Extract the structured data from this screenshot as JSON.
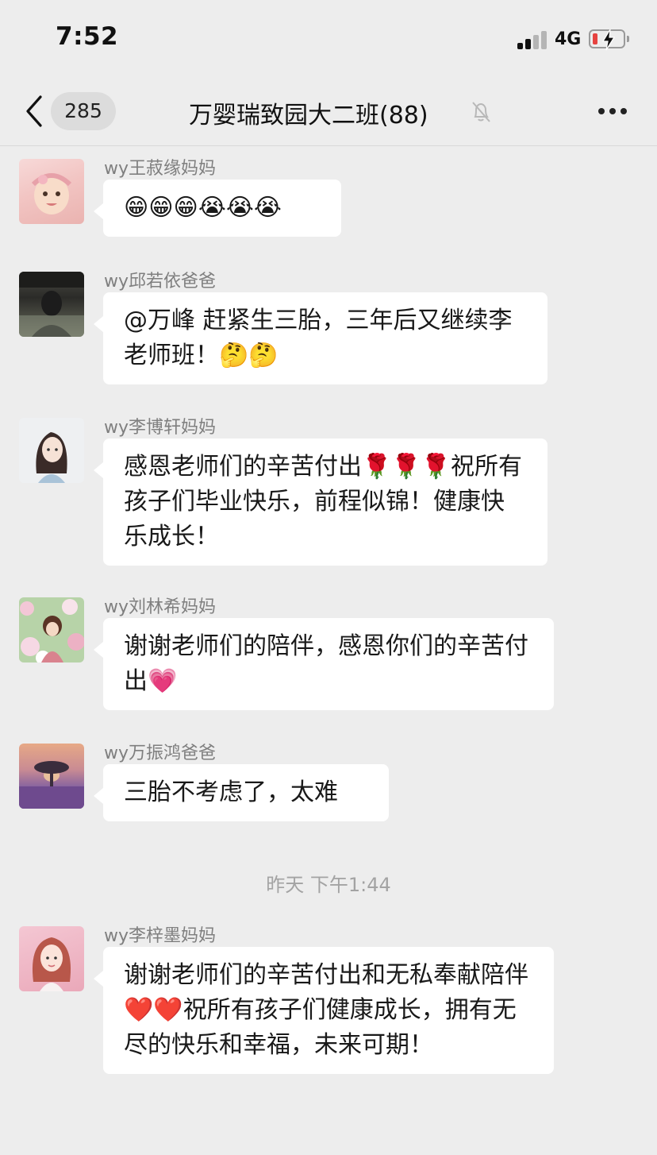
{
  "status_bar": {
    "time": "7:52",
    "network": "4G"
  },
  "nav": {
    "unread_count": "285",
    "title": "万婴瑞致园大二班(88)"
  },
  "messages": [
    {
      "sender": "wy王菽缘妈妈",
      "text": "😁😁😁😭😭😭",
      "avatar": "baby-with-headband"
    },
    {
      "sender": "wy邱若依爸爸",
      "text": "@万峰  赶紧生三胎，三年后又继续李老师班！🤔🤔",
      "avatar": "man-portrait"
    },
    {
      "sender": "wy李博轩妈妈",
      "text": "感恩老师们的辛苦付出🌹🌹🌹祝所有孩子们毕业快乐，前程似锦！健康快乐成长！",
      "avatar": "illustrated-girl"
    },
    {
      "sender": "wy刘林希妈妈",
      "text": "谢谢老师们的陪伴，感恩你们的辛苦付出💗",
      "avatar": "anime-girl-flowers"
    },
    {
      "sender": "wy万振鸿爸爸",
      "text": "三胎不考虑了，太难",
      "avatar": "tree-sunset"
    },
    {
      "sender": "wy李梓墨妈妈",
      "text": "谢谢老师们的辛苦付出和无私奉献陪伴❤️❤️祝所有孩子们健康成长，拥有无尽的快乐和幸福，未来可期！",
      "avatar": "woman-portrait"
    }
  ],
  "timestamp": "昨天 下午1:44",
  "colors": {
    "background": "#ededed",
    "bubble": "#ffffff",
    "sender_text": "#7f7f7f",
    "battery_low": "#e64340"
  },
  "icons": {
    "back": "chevron-left-icon",
    "mute": "bell-slash-icon",
    "more": "ellipsis-icon"
  }
}
